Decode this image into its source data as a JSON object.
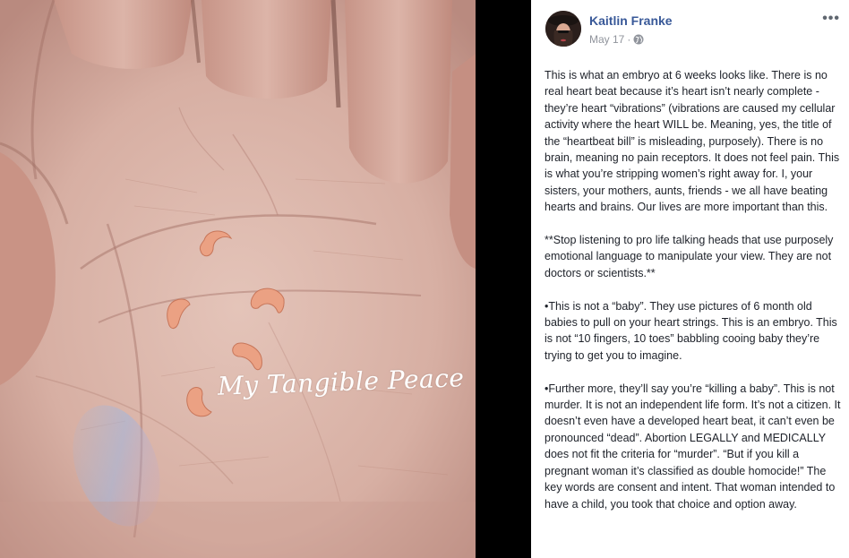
{
  "photo": {
    "watermark": "My Tangible Peace"
  },
  "post": {
    "author": "Kaitlin Franke",
    "date": "May 17",
    "separator": "·",
    "privacy_icon": "globe-icon",
    "more_icon": "more-options-icon",
    "more_glyph": "•••",
    "paragraphs": [
      "This is what an embryo at 6 weeks looks like. There is no real heart beat because it’s heart isn’t nearly complete - they’re heart “vibrations” (vibrations are caused my cellular activity where the heart WILL be. Meaning, yes, the title of the “heartbeat bill” is misleading, purposely). There is no brain, meaning no pain receptors. It does not feel pain. This is what you’re stripping women’s right away for. I, your sisters, your mothers, aunts, friends - we all have beating hearts and brains. Our lives are more important than this.",
      "**Stop listening to pro life talking heads that use purposely emotional language to manipulate your view. They are not doctors or scientists.**",
      "•This is not a “baby”. They use pictures of 6 month old babies to pull on your heart strings. This is an embryo. This is not “10 fingers, 10 toes” babbling cooing baby they’re trying to get you to imagine.",
      "•Further more, they’ll say you’re “killing a baby”. This is not murder. It is not an independent life form. It’s not a citizen. It doesn’t even have a developed heart beat, it can’t even be pronounced “dead”. Abortion LEGALLY and MEDICALLY does not fit the criteria for “murder”. “But if you kill a pregnant woman it’s classified as double homocide!” The key words are consent and intent. That woman intended to have a child, you took that choice and option away."
    ]
  },
  "colors": {
    "author_link": "#385898",
    "meta_text": "#90949c",
    "body_text": "#1d2129",
    "background": "#000000"
  }
}
